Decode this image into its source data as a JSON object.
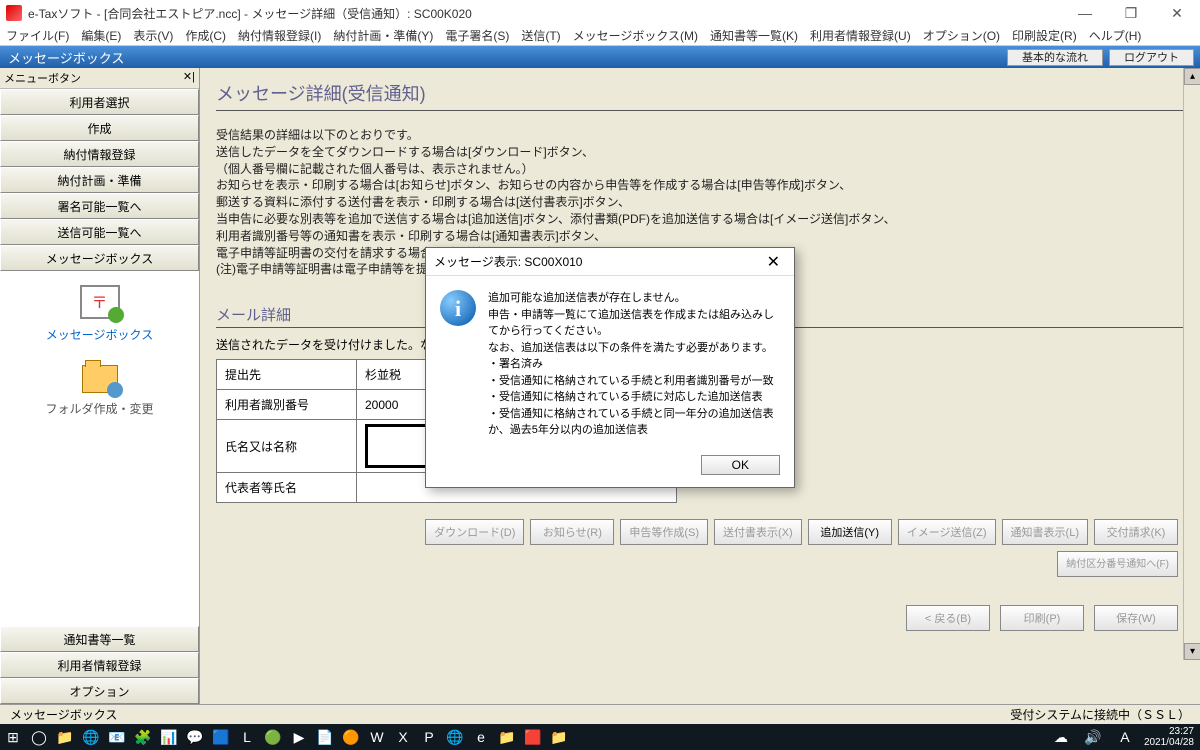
{
  "window": {
    "title": "e-Taxソフト - [合同会社エストピア.ncc] - メッセージ詳細（受信通知）: SC00K020",
    "minimize": "―",
    "maximize": "❐",
    "close": "✕"
  },
  "menu": [
    "ファイル(F)",
    "編集(E)",
    "表示(V)",
    "作成(C)",
    "納付情報登録(I)",
    "納付計画・準備(Y)",
    "電子署名(S)",
    "送信(T)",
    "メッセージボックス(M)",
    "通知書等一覧(K)",
    "利用者情報登録(U)",
    "オプション(O)",
    "印刷設定(R)",
    "ヘルプ(H)"
  ],
  "blueband": {
    "title": "メッセージボックス",
    "flow_btn": "基本的な流れ",
    "logout_btn": "ログアウト"
  },
  "sidebar": {
    "header": "メニューボタン",
    "close_marks": "✕|",
    "top_buttons": [
      "利用者選択",
      "作成",
      "納付情報登録",
      "納付計画・準備",
      "署名可能一覧へ",
      "送信可能一覧へ",
      "メッセージボックス"
    ],
    "msgbox_link": "メッセージボックス",
    "folder_link": "フォルダ作成・変更",
    "bottom_buttons": [
      "通知書等一覧",
      "利用者情報登録",
      "オプション"
    ]
  },
  "page": {
    "title": "メッセージ詳細(受信通知)",
    "explain": [
      "受信結果の詳細は以下のとおりです。",
      "送信したデータを全てダウンロードする場合は[ダウンロード]ボタン、",
      "（個人番号欄に記載された個人番号は、表示されません。）",
      "お知らせを表示・印刷する場合は[お知らせ]ボタン、お知らせの内容から申告等を作成する場合は[申告等作成]ボタン、",
      "郵送する資料に添付する送付書を表示・印刷する場合は[送付書表示]ボタン、",
      "当申告に必要な別表等を追加で送信する場合は[追加送信]ボタン、添付書類(PDF)を追加送信する場合は[イメージ送信]ボタン、",
      "利用者識別番号等の通知書を表示・印刷する場合は[通知書表示]ボタン、",
      "電子申請等証明書の交付を請求する場合は[交付請求]ボタンを押してください。",
      "(注)電子申請等証明書は電子申請等を提出した日付で提出先の税務署長から交付されます。"
    ],
    "mail_heading": "メール詳細",
    "mail_note": "送信されたデータを受け付けました。な                                                                                                              ありますので、ご了承ください。",
    "table": {
      "r1h": "提出先",
      "r1v": "杉並税",
      "r2h": "利用者識別番号",
      "r2v": "20000",
      "r3h": "氏名又は名称",
      "r3v": "",
      "r4h": "代表者等氏名",
      "r4v": ""
    },
    "buttons": [
      "ダウンロード(D)",
      "お知らせ(R)",
      "申告等作成(S)",
      "送付書表示(X)",
      "追加送信(Y)",
      "イメージ送信(Z)",
      "通知書表示(L)",
      "交付請求(K)"
    ],
    "extra_btn": "納付区分番号通知へ(F)",
    "nav_btns": [
      "< 戻る(B)",
      "印刷(P)",
      "保存(W)"
    ]
  },
  "modal": {
    "title": "メッセージ表示: SC00X010",
    "lines": [
      "追加可能な追加送信表が存在しません。",
      "申告・申請等一覧にて追加送信表を作成または組み込みしてから行ってください。",
      "なお、追加送信表は以下の条件を満たす必要があります。",
      "",
      "・署名済み",
      "・受信通知に格納されている手続と利用者識別番号が一致",
      "・受信通知に格納されている手続に対応した追加送信表",
      "・受信通知に格納されている手続と同一年分の追加送信表か、過去5年分以内の追加送信表"
    ],
    "ok": "OK",
    "close": "✕"
  },
  "status": {
    "left": "メッセージボックス",
    "right": "受付システムに接続中（ＳＳＬ）"
  },
  "taskbar": {
    "time": "23:27",
    "date": "2021/04/28",
    "icons": [
      "⊞",
      "◯",
      "📁",
      "🌐",
      "📧",
      "🧩",
      "📊",
      "💬",
      "🟦",
      "L",
      "🟢",
      "▶",
      "📄",
      "🟠",
      "W",
      "X",
      "P",
      "🌐",
      "e",
      "📁",
      "🟥",
      "📁"
    ],
    "tray": [
      "☁",
      "🔊",
      "A"
    ]
  }
}
